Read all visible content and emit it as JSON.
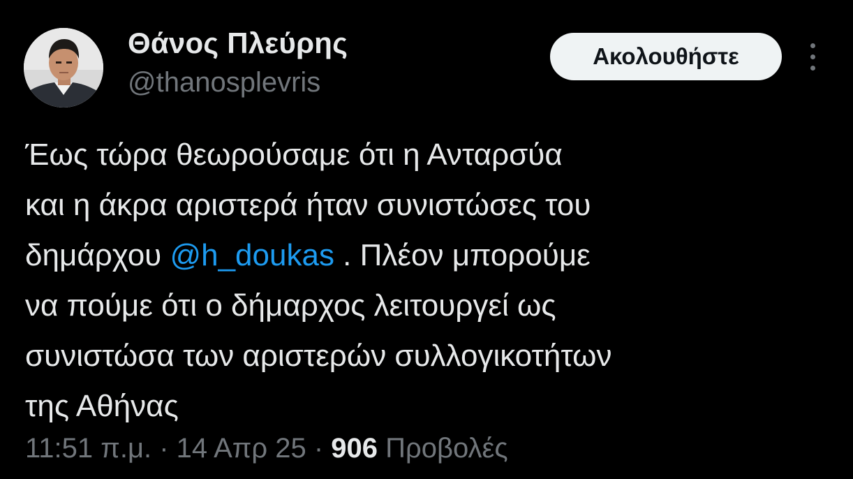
{
  "author": {
    "display_name": "Θάνος Πλεύρης",
    "handle": "@thanosplevris",
    "avatar_icon": "profile-photo"
  },
  "follow_button": {
    "label": "Ακολουθήστε"
  },
  "more_icon": "more-vertical-icon",
  "tweet": {
    "line1": "Έως τώρα θεωρούσαμε ότι η Ανταρσύα",
    "line2": "και η άκρα αριστερά ήταν συνιστώσες του",
    "line3_before": "δημάρχου ",
    "mention": "@h_doukas",
    "line3_after": " . Πλέον μπορούμε",
    "line4": "να πούμε ότι ο δήμαρχος λειτουργεί ως",
    "line5": "συνιστώσα των αριστερών συλλογικοτήτων",
    "line6": "της Αθήνας"
  },
  "meta": {
    "time": "11:51 π.μ.",
    "separator": " · ",
    "date": "14 Απρ 25",
    "views_count": "906",
    "views_label": " Προβολές"
  },
  "colors": {
    "background": "#000000",
    "text": "#e7e9ea",
    "secondary": "#71767b",
    "link": "#1d9bf0",
    "button_bg": "#eff3f4"
  }
}
